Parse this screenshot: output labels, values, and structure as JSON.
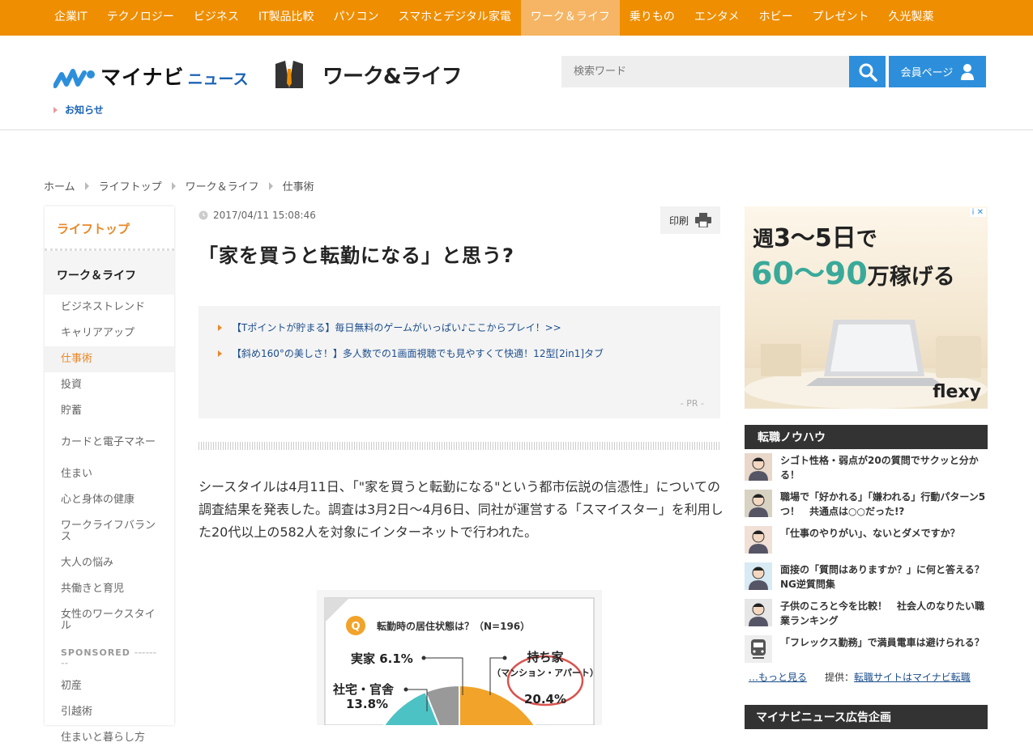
{
  "topnav": {
    "items": [
      "企業IT",
      "テクノロジー",
      "ビジネス",
      "IT製品比較",
      "パソコン",
      "スマホとデジタル家電",
      "ワーク＆ライフ",
      "乗りもの",
      "エンタメ",
      "ホビー",
      "プレゼント",
      "久光製薬"
    ],
    "active_index": 6
  },
  "header": {
    "brand_main": "マイナビ",
    "brand_sub": "ニュース",
    "section_title": "ワーク&ライフ",
    "search_placeholder": "検索ワード",
    "member_label": "会員ページ",
    "notice": "お知らせ"
  },
  "breadcrumb": [
    "ホーム",
    "ライフトップ",
    "ワーク＆ライフ",
    "仕事術"
  ],
  "sidebar": {
    "top": "ライフトップ",
    "section": "ワーク＆ライフ",
    "items": [
      "ビジネストレンド",
      "キャリアアップ",
      "仕事術",
      "投資",
      "貯蓄",
      "カードと電子マネー",
      "住まい",
      "心と身体の健康",
      "ワークライフバランス",
      "大人の悩み",
      "共働きと育児",
      "女性のワークスタイル"
    ],
    "active_index": 2,
    "sponsored_label": "SPONSORED",
    "sponsored_items": [
      "初産",
      "引越術",
      "住まいと暮らし方"
    ]
  },
  "article": {
    "date": "2017/04/11 15:08:46",
    "print_label": "印刷",
    "title": "「家を買うと転勤になる」と思う?",
    "pr_links": [
      "【Tポイントが貯まる】毎日無料のゲームがいっぱい♪ここからプレイ！>>",
      "【斜め160°の美しさ！】多人数での1画面視聴でも見やすくて快適！12型[2in1]タブ"
    ],
    "pr_label": "- PR -",
    "body": "シースタイルは4月11日、「\"家を買うと転勤になる\"という都市伝説の信憑性」についての調査結果を発表した。調査は3月2日～4月6日、同社が運営する「スマイスター」を利用した20代以上の582人を対象にインターネットで行われた。"
  },
  "chart_data": {
    "type": "pie",
    "title": "転勤時の居住状態は？（N=196）",
    "question_mark": "Q",
    "slices": [
      {
        "label": "持ち家",
        "sublabel": "（マンション・アパート）",
        "value": 20.4,
        "color": "#f2a32a"
      },
      {
        "label": "実家",
        "value": 6.1,
        "color": "#999999"
      },
      {
        "label": "社宅・官舎",
        "value": 13.8,
        "color": "#4cc2c4"
      }
    ],
    "value_suffix": "%"
  },
  "ad": {
    "line1_pre": "週",
    "line1_big": "3～5日",
    "line1_post": "で",
    "line2_big": "60～90",
    "line2_tail": "万稼げる",
    "brand": "flexy",
    "ad_marker": "i ✕",
    "accent": "#3aa99a"
  },
  "knowhow": {
    "title": "転職ノウハウ",
    "items": [
      "シゴト性格・弱点が20の質問でサクッと分かる！",
      "職場で「好かれる」「嫌われる」行動パターン5つ！　共通点は○○だった!?",
      "「仕事のやりがい」、ないとダメですか？",
      "面接の「質問はありますか？」に何と答える？　NG逆質問集",
      "子供のころと今を比較！　社会人のなりたい職業ランキング",
      "「フレックス勤務」で満員電車は避けられる？"
    ],
    "more": "…もっと見る",
    "provider_pre": "提供：",
    "provider_link": "転職サイトはマイナビ転職"
  },
  "ad_box": {
    "title": "マイナビニュース広告企画"
  },
  "colors": {
    "nav": "#ee8e00",
    "nav_active": "#f5b564",
    "blue": "#2d8fdb",
    "orange_text": "#e8892a"
  }
}
